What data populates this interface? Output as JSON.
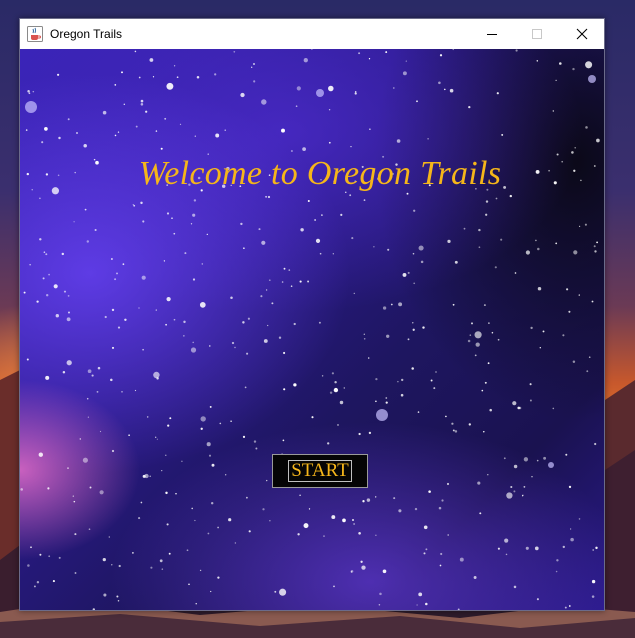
{
  "window": {
    "title": "Oregon Trails",
    "icon": "java-cup-icon"
  },
  "controls": {
    "minimize_icon": "minimize-icon",
    "maximize_icon": "maximize-icon",
    "close_icon": "close-icon"
  },
  "main": {
    "welcome_text": "Welcome to Oregon Trails",
    "start_label": "START"
  },
  "colors": {
    "accent_text": "#f5b61a",
    "button_bg": "#050505",
    "titlebar_bg": "#ffffff"
  }
}
